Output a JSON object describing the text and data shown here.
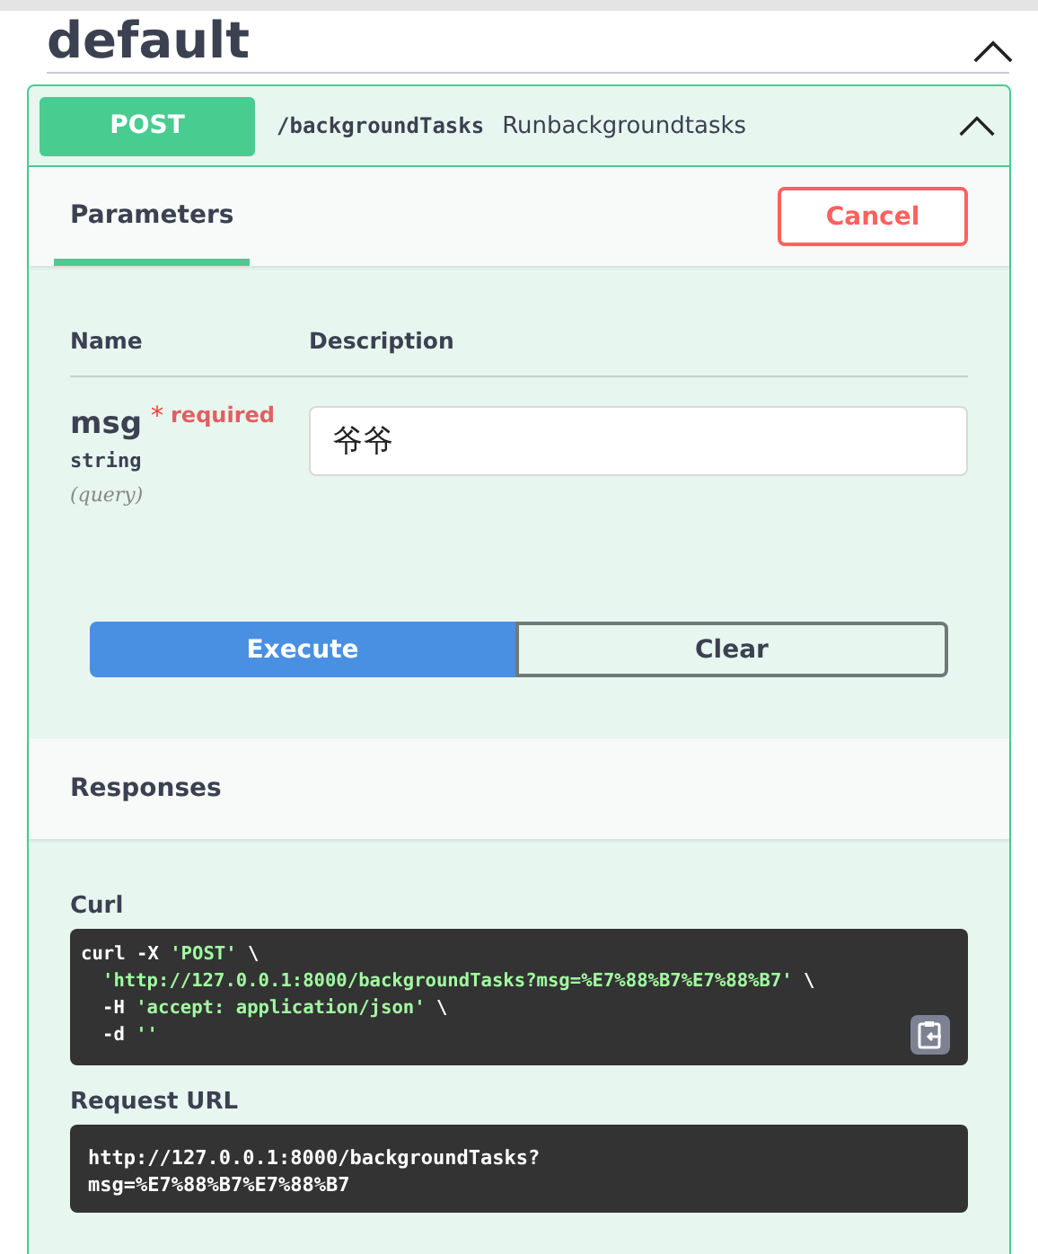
{
  "section": {
    "title": "default",
    "expanded": true
  },
  "operation": {
    "method": "POST",
    "path": "/backgroundTasks",
    "summary": "Runbackgroundtasks",
    "expanded": true
  },
  "tabs": [
    {
      "label": "Parameters",
      "selected": true
    }
  ],
  "cancel_button": "Cancel",
  "parameters": {
    "columns": [
      "Name",
      "Description"
    ],
    "rows": [
      {
        "name": "msg",
        "required_mark": "*",
        "required_label": "required",
        "type": "string",
        "location": "(query)",
        "value": "爷爷"
      }
    ]
  },
  "execute_button": "Execute",
  "clear_button": "Clear",
  "responses": {
    "title": "Responses",
    "curl_label": "Curl",
    "curl_lines": [
      {
        "indent": false,
        "segments": [
          {
            "kind": "plain",
            "text": "curl -X "
          },
          {
            "kind": "string",
            "text": "'POST'"
          },
          {
            "kind": "plain",
            "text": " \\"
          }
        ]
      },
      {
        "indent": true,
        "segments": [
          {
            "kind": "string",
            "text": "'http://127.0.0.1:8000/backgroundTasks?msg=%E7%88%B7%E7%88%B7'"
          },
          {
            "kind": "plain",
            "text": " \\"
          }
        ]
      },
      {
        "indent": true,
        "segments": [
          {
            "kind": "plain",
            "text": "-H "
          },
          {
            "kind": "string",
            "text": "'accept: application/json'"
          },
          {
            "kind": "plain",
            "text": " \\"
          }
        ]
      },
      {
        "indent": true,
        "segments": [
          {
            "kind": "plain",
            "text": "-d "
          },
          {
            "kind": "string",
            "text": "''"
          }
        ]
      }
    ],
    "request_url_label": "Request URL",
    "request_url_lines": [
      "http://127.0.0.1:8000/backgroundTasks?",
      "msg=%E7%88%B7%E7%88%B7"
    ]
  }
}
